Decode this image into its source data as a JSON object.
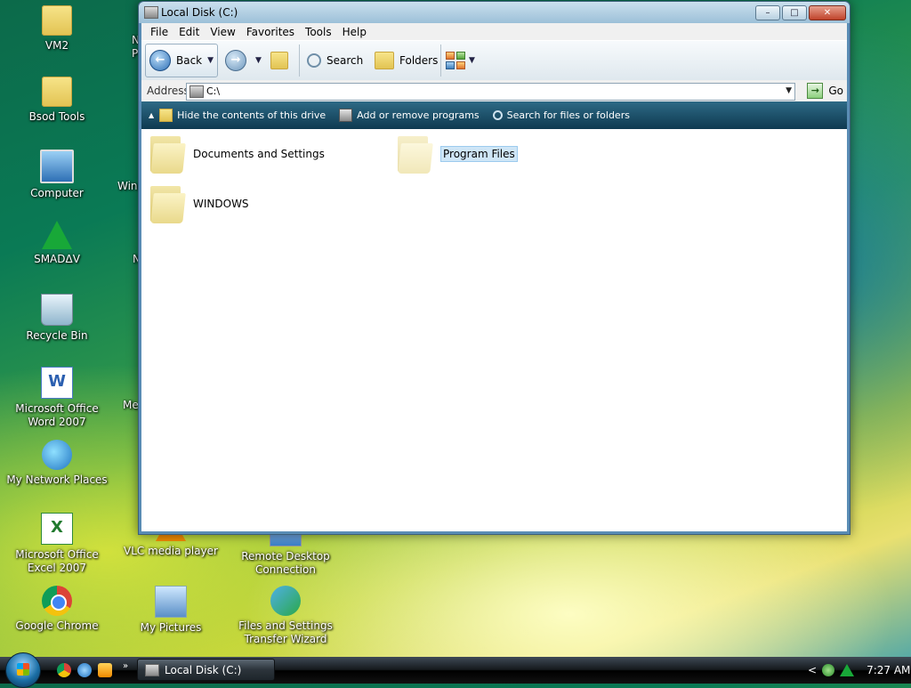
{
  "desktop": {
    "icons": [
      {
        "label": "VM2"
      },
      {
        "label": "Bsod Tools"
      },
      {
        "label": "Computer"
      },
      {
        "label": "SMADΔV"
      },
      {
        "label": "Recycle Bin"
      },
      {
        "label": "Microsoft Office Word 2007"
      },
      {
        "label": "My Network Places"
      },
      {
        "label": "Microsoft Office Excel 2007"
      },
      {
        "label": "Google Chrome"
      },
      {
        "label": "VLC media player"
      },
      {
        "label": "My Pictures"
      },
      {
        "label": "Remote Desktop Connection"
      },
      {
        "label": "Files and Settings Transfer Wizard"
      }
    ],
    "partial_labels": [
      "N",
      "P",
      "Wind",
      "N",
      "Me"
    ]
  },
  "window": {
    "title": "Local Disk (C:)",
    "buttons": {
      "minimize": "–",
      "maximize": "□",
      "close": "✕"
    },
    "menu": [
      "File",
      "Edit",
      "View",
      "Favorites",
      "Tools",
      "Help"
    ],
    "toolbar": {
      "back_label": "Back",
      "search_label": "Search",
      "folders_label": "Folders"
    },
    "address": {
      "label": "Address",
      "value": "C:\\",
      "go_label": "Go"
    },
    "tasks": [
      {
        "label": "Hide the contents of this drive",
        "icon": "folder-icon"
      },
      {
        "label": "Add or remove programs",
        "icon": "programs-icon"
      },
      {
        "label": "Search for files or folders",
        "icon": "search-icon"
      }
    ],
    "items": [
      {
        "label": "Documents and Settings",
        "selected": false
      },
      {
        "label": "Program Files",
        "selected": true
      },
      {
        "label": "WINDOWS",
        "selected": false
      }
    ]
  },
  "taskbar": {
    "active_window": "Local Disk (C:)",
    "overflow": "»",
    "tray_arrow": "<",
    "clock": "7:27 AM"
  },
  "colors": {
    "selection": "#cfe6f7",
    "task_pane": "#1c4f68"
  }
}
